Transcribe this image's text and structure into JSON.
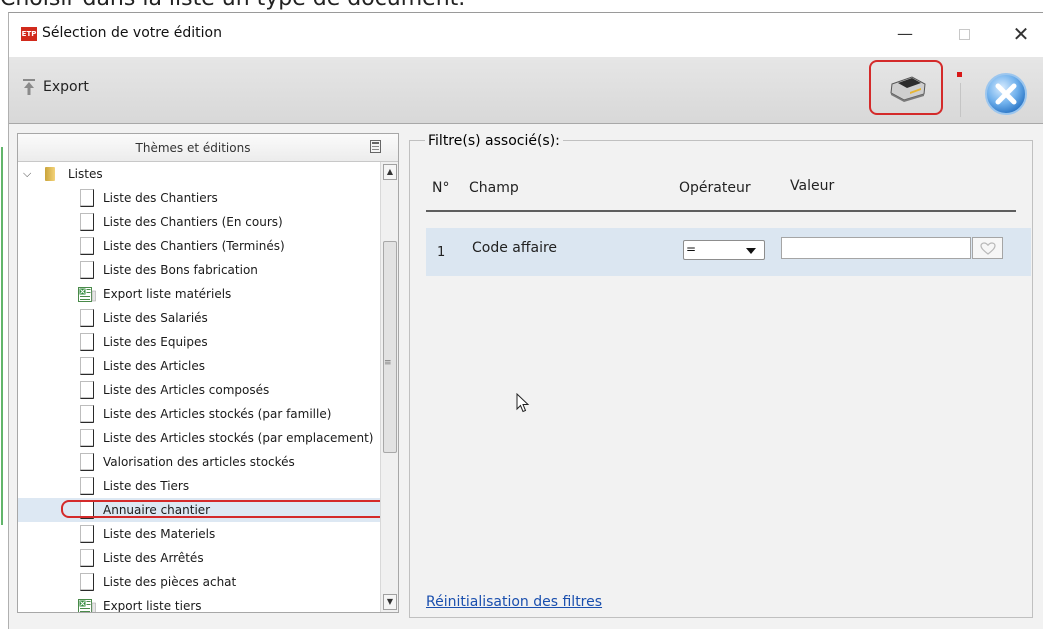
{
  "caption": "Choisir dans la liste un type de document.",
  "window": {
    "title": "Sélection de votre édition",
    "app_icon": "ETP"
  },
  "toolbar": {
    "export_label": "Export"
  },
  "left_panel": {
    "header": "Thèmes et éditions",
    "root": "Listes",
    "items": [
      {
        "label": "Liste des Chantiers",
        "icon": "doc"
      },
      {
        "label": "Liste des Chantiers (En cours)",
        "icon": "doc"
      },
      {
        "label": "Liste des Chantiers (Terminés)",
        "icon": "doc"
      },
      {
        "label": "Liste des Bons fabrication",
        "icon": "doc"
      },
      {
        "label": "Export liste matériels",
        "icon": "xls"
      },
      {
        "label": "Liste des Salariés",
        "icon": "doc"
      },
      {
        "label": "Liste des Equipes",
        "icon": "doc"
      },
      {
        "label": "Liste des Articles",
        "icon": "doc"
      },
      {
        "label": "Liste des Articles composés",
        "icon": "doc"
      },
      {
        "label": "Liste des Articles stockés (par famille)",
        "icon": "doc"
      },
      {
        "label": "Liste des Articles stockés (par emplacement)",
        "icon": "doc"
      },
      {
        "label": "Valorisation des articles stockés",
        "icon": "doc"
      },
      {
        "label": "Liste des Tiers",
        "icon": "doc"
      },
      {
        "label": "Annuaire chantier",
        "icon": "doc",
        "selected": true
      },
      {
        "label": "Liste des Materiels",
        "icon": "doc"
      },
      {
        "label": "Liste des Arrêtés",
        "icon": "doc"
      },
      {
        "label": "Liste des pièces achat",
        "icon": "doc"
      },
      {
        "label": "Export liste tiers",
        "icon": "xls"
      }
    ]
  },
  "filters": {
    "legend": "Filtre(s) associé(s):",
    "columns": {
      "no": "N°",
      "champ": "Champ",
      "operateur": "Opérateur",
      "valeur": "Valeur"
    },
    "rows": [
      {
        "no": "1",
        "champ": "Code affaire",
        "operateur": "=",
        "valeur": ""
      }
    ],
    "reset_link": "Réinitialisation des filtres"
  },
  "colors": {
    "highlight": "#d42a2a",
    "row_bg": "#dbe6f1",
    "link": "#1a4fae"
  }
}
